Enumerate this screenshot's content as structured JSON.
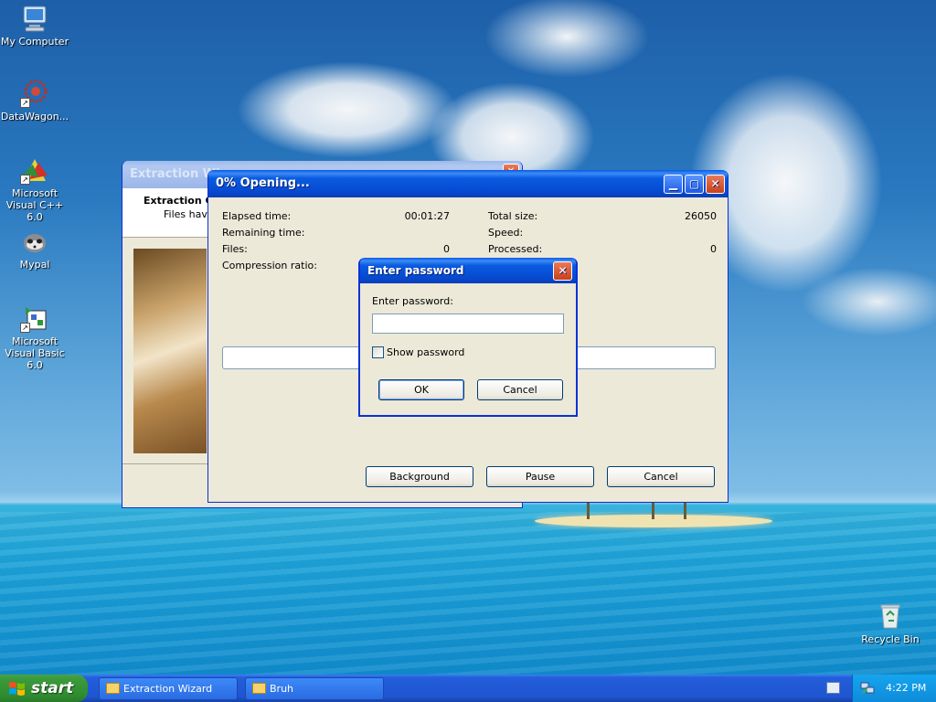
{
  "desktop": {
    "icons": [
      {
        "label": "My Computer",
        "icon": "my-computer-icon"
      },
      {
        "label": "DataWagon...",
        "icon": "datawagon-icon"
      },
      {
        "label": "Microsoft Visual C++ 6.0",
        "icon": "visual-cpp-icon"
      },
      {
        "label": "Mypal",
        "icon": "mypal-icon"
      },
      {
        "label": "Microsoft Visual Basic 6.0",
        "icon": "visual-basic-icon"
      },
      {
        "label": "Recycle Bin",
        "icon": "recycle-bin-icon"
      }
    ]
  },
  "wizard": {
    "title": "Extraction Wiz",
    "heading": "Extraction C",
    "subtext": "Files have"
  },
  "progress": {
    "title": "0% Opening...",
    "elapsed_label": "Elapsed time:",
    "elapsed_value": "00:01:27",
    "remaining_label": "Remaining time:",
    "files_label": "Files:",
    "files_value": "0",
    "ratio_label": "Compression ratio:",
    "total_label": "Total size:",
    "total_value": "26050",
    "speed_label": "Speed:",
    "processed_label": "Processed:",
    "processed_value": "0",
    "progress_fraction": 0,
    "buttons": {
      "background": "Background",
      "pause": "Pause",
      "cancel": "Cancel"
    }
  },
  "password_dialog": {
    "title": "Enter password",
    "prompt": "Enter password:",
    "value": "",
    "show_password": "Show password",
    "ok": "OK",
    "cancel": "Cancel"
  },
  "taskbar": {
    "start": "start",
    "tasks": [
      "Extraction Wizard",
      "Bruh"
    ],
    "clock": "4:22 PM"
  },
  "colors": {
    "titlebar": "#0a58e8",
    "window_bg": "#ece9d8",
    "taskbar": "#245edb",
    "start": "#3b9b3b"
  }
}
